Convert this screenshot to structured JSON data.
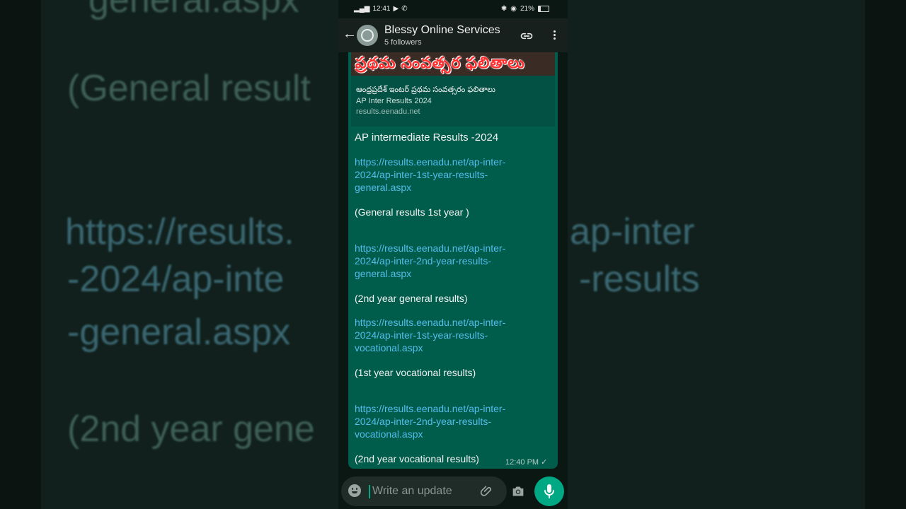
{
  "status_bar": {
    "time": "12:41",
    "battery": "21%"
  },
  "header": {
    "channel_name": "Blessy Online Services",
    "followers": "5 followers"
  },
  "link_preview": {
    "banner_text": "ప్రథమ సంవత్సర ఫలితాలు",
    "title": "ఆంధ్రప్రదేశ్ ఇంటర్ ప్రథమ సంవత్సరం ఫలితాలు",
    "description": "AP Inter Results 2024",
    "domain": "results.eenadu.net"
  },
  "message": {
    "heading": "AP intermediate Results -2024",
    "link1": "https://results.eenadu.net/ap-inter-2024/ap-inter-1st-year-results-general.aspx",
    "label1": "(General results 1st year )",
    "link2": "https://results.eenadu.net/ap-inter-2024/ap-inter-2nd-year-results-general.aspx",
    "label2": "(2nd year general results)",
    "link3": "https://results.eenadu.net/ap-inter-2024/ap-inter-1st-year-results-vocational.aspx",
    "label3": "(1st year vocational results)",
    "link4": "https://results.eenadu.net/ap-inter-2024/ap-inter-2nd-year-results-vocational.aspx",
    "label4": "(2nd year vocational results)",
    "time": "12:40 PM ✓"
  },
  "input": {
    "placeholder": "Write an update"
  },
  "background_text": {
    "t1": "general.aspx",
    "t2": "(General result",
    "t3": "https://results.",
    "t3b": "ap-inter",
    "t4": "-2024/ap-inte",
    "t4b": "-results",
    "t5": "-general.aspx",
    "t6": "(2nd year gene"
  },
  "icons": [
    "back-arrow-icon",
    "channel-avatar-icon",
    "link-icon",
    "more-options-icon",
    "emoji-icon",
    "attach-icon",
    "camera-icon",
    "mic-icon"
  ]
}
